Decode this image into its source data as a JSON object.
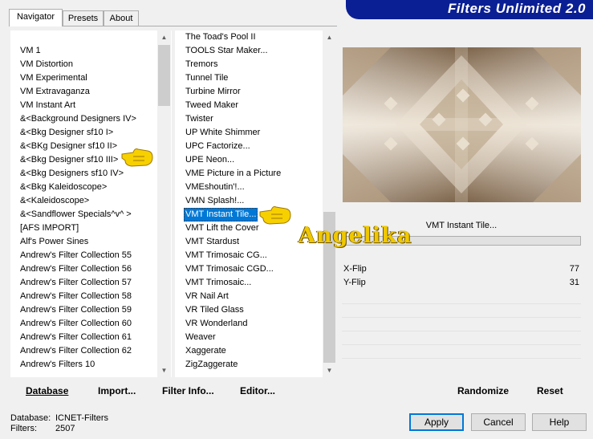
{
  "tabs": [
    {
      "label": "Navigator",
      "active": true
    },
    {
      "label": "Presets",
      "active": false
    },
    {
      "label": "About",
      "active": false
    }
  ],
  "banner": {
    "title": "Filters Unlimited 2.0",
    "bg": "#0b1f94"
  },
  "categories": {
    "items": [
      "VM 1",
      "VM Distortion",
      "VM Experimental",
      "VM Extravaganza",
      "VM Instant Art",
      "&<Background Designers IV>",
      "&<Bkg Designer sf10 I>",
      "&<BKg Designer sf10 II>",
      "&<Bkg Designer sf10 III>",
      "&<Bkg Designers sf10 IV>",
      "&<Bkg Kaleidoscope>",
      "&<Kaleidoscope>",
      "&<Sandflower Specials^v^ >",
      "[AFS IMPORT]",
      "Alf's Power Sines",
      "Andrew's Filter Collection 55",
      "Andrew's Filter Collection 56",
      "Andrew's Filter Collection 57",
      "Andrew's Filter Collection 58",
      "Andrew's Filter Collection 59",
      "Andrew's Filter Collection 60",
      "Andrew's Filter Collection 61",
      "Andrew's Filter Collection 62",
      "Andrew's Filters 10"
    ]
  },
  "filters": {
    "items": [
      "The Toad's Pool II",
      "TOOLS Star Maker...",
      "Tremors",
      "Tunnel Tile",
      "Turbine Mirror",
      "Tweed Maker",
      "Twister",
      "UP White Shimmer",
      "UPC Factorize...",
      "UPE Neon...",
      "VME Picture in a Picture",
      "VMEshoutin'!...",
      "VMN Splash!...",
      "VMT Instant Tile...",
      "VMT Lift the Cover",
      "VMT Stardust",
      "VMT Trimosaic CG...",
      "VMT Trimosaic CGD...",
      "VMT Trimosaic...",
      "VR Nail Art",
      "VR Tiled Glass",
      "VR Wonderland",
      "Weaver",
      "Xaggerate",
      "ZigZaggerate"
    ],
    "selected_index": 13
  },
  "preview": {
    "selected_filter_name": "VMT Instant Tile...",
    "colors": {
      "dark": "#7c6349",
      "mid": "#b8a184",
      "light": "#ece2d3"
    }
  },
  "watermark": {
    "text": "Angelika"
  },
  "controls": [
    {
      "label": "X-Flip",
      "value": "77"
    },
    {
      "label": "Y-Flip",
      "value": "31"
    }
  ],
  "left_actions": {
    "database": "Database",
    "import": "Import...",
    "filter_info": "Filter Info...",
    "editor": "Editor..."
  },
  "right_actions": {
    "randomize": "Randomize",
    "reset": "Reset"
  },
  "status": {
    "database_label": "Database:",
    "database_value": "ICNET-Filters",
    "filters_label": "Filters:",
    "filters_value": "2507"
  },
  "dialog_buttons": {
    "apply": "Apply",
    "cancel": "Cancel",
    "help": "Help"
  },
  "accent": "#0078d7"
}
